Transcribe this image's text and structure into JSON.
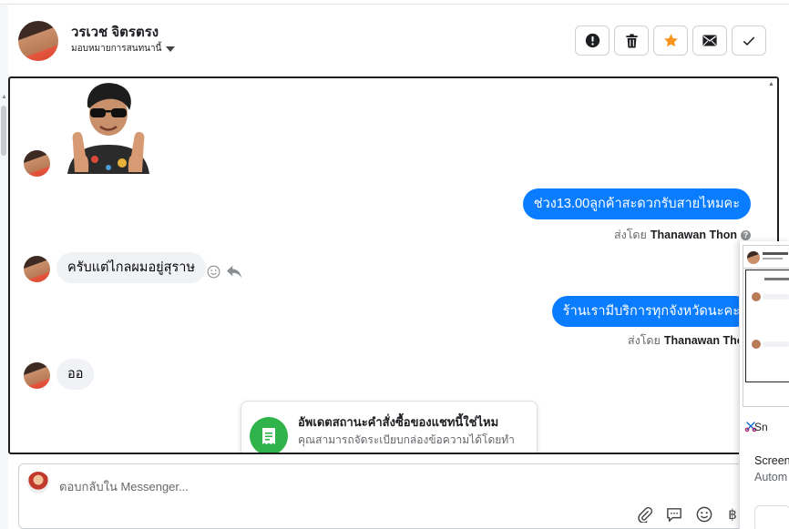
{
  "header": {
    "contact_name": "วรเวช จิตรตรง",
    "assign_label": "มอบหมายการสนทนานี้",
    "actions": [
      {
        "name": "report-button",
        "icon": "exclamation-circle-icon"
      },
      {
        "name": "delete-button",
        "icon": "trash-icon"
      },
      {
        "name": "star-button",
        "icon": "star-icon",
        "color": "#f7931e"
      },
      {
        "name": "mark-unread-button",
        "icon": "envelope-icon"
      },
      {
        "name": "mark-done-button",
        "icon": "checkmark-icon"
      }
    ]
  },
  "messages": [
    {
      "type": "sticker",
      "from": "customer",
      "sticker": "thumbs-up-sticker"
    },
    {
      "type": "outgoing",
      "text": "ช่วง13.00ลูกค้าสะดวกรับสายไหมคะ",
      "sent_by_prefix": "ส่งโดย",
      "sent_by": "Thanawan Thon"
    },
    {
      "type": "incoming",
      "text": "ครับแต่ไกลผมอยู่สุราษ"
    },
    {
      "type": "outgoing",
      "text": "ร้านเรามีบริการทุกจังหวัดนะคะ",
      "sent_by_prefix": "ส่งโดย",
      "sent_by": "Thanawan Thon"
    },
    {
      "type": "incoming",
      "text": "ออ"
    }
  ],
  "notice": {
    "title": "อัพเดตสถานะคำสั่งซื้อของแชทนี้ใช่ไหม",
    "description": "คุณสามารถจัดระเบียบกล่องข้อความได้โดยทำ"
  },
  "composer": {
    "placeholder": "ตอบกลับใน Messenger..."
  },
  "popup": {
    "app_name": "Sn",
    "line1": "Screen",
    "line2": "Autom"
  },
  "colors": {
    "accent_blue": "#0a7cff",
    "bubble_gray": "#f0f2f5",
    "star_orange": "#f7931e",
    "notice_green": "#2fb34a"
  }
}
